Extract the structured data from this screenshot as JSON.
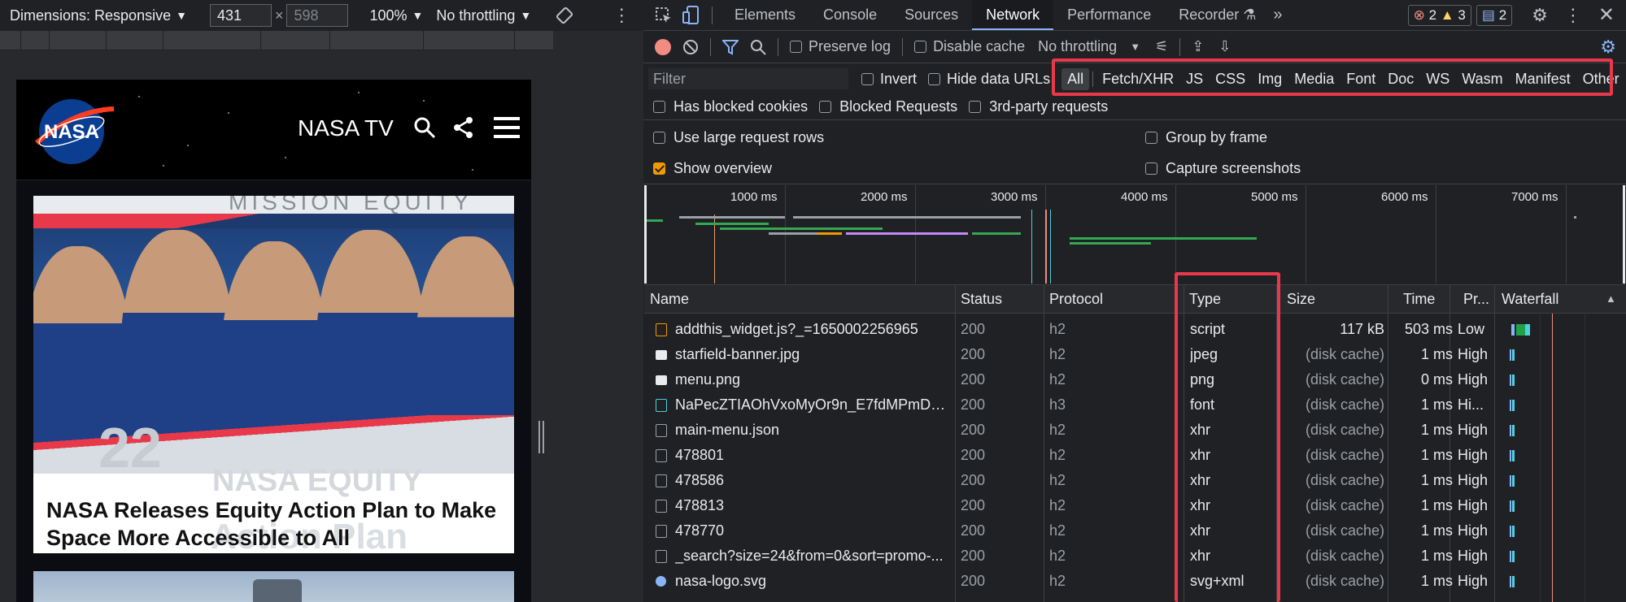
{
  "device_toolbar": {
    "dimensions_label": "Dimensions: Responsive",
    "width": "431",
    "height": "598",
    "zoom": "100%",
    "throttling": "No throttling"
  },
  "nasa_page": {
    "logo_text": "NASA",
    "nav_label": "NASA TV",
    "banner_text": "MISSION EQUITY",
    "card_title": "NASA Releases Equity Action Plan to Make Space More Accessible to All",
    "overlay_year": "22",
    "overlay_text_1": "NASA EQUITY",
    "overlay_text_2": "Action Plan"
  },
  "devtools": {
    "tabs": [
      {
        "label": "Elements"
      },
      {
        "label": "Console"
      },
      {
        "label": "Sources"
      },
      {
        "label": "Network"
      },
      {
        "label": "Performance"
      },
      {
        "label": "Recorder"
      }
    ],
    "active_tab": "Network",
    "errors": "2",
    "warnings": "3",
    "messages": "2",
    "toolbar": {
      "preserve_log": "Preserve log",
      "disable_cache": "Disable cache",
      "throttling": "No throttling"
    },
    "filter": {
      "placeholder": "Filter",
      "invert": "Invert",
      "hide_data_urls": "Hide data URLs",
      "types": [
        "All",
        "Fetch/XHR",
        "JS",
        "CSS",
        "Img",
        "Media",
        "Font",
        "Doc",
        "WS",
        "Wasm",
        "Manifest",
        "Other"
      ],
      "active_type": "All"
    },
    "options": {
      "has_blocked_cookies": "Has blocked cookies",
      "blocked_requests": "Blocked Requests",
      "third_party": "3rd-party requests",
      "large_rows": "Use large request rows",
      "group_by_frame": "Group by frame",
      "show_overview": "Show overview",
      "show_overview_checked": true,
      "capture_screenshots": "Capture screenshots"
    },
    "timeline_ticks": [
      "1000 ms",
      "2000 ms",
      "3000 ms",
      "4000 ms",
      "5000 ms",
      "6000 ms",
      "7000 ms"
    ],
    "columns": [
      "Name",
      "Status",
      "Protocol",
      "Type",
      "Size",
      "Time",
      "Pr...",
      "Waterfall"
    ],
    "rows": [
      {
        "name": "addthis_widget.js?_=1650002256965",
        "status": "200",
        "protocol": "h2",
        "type": "script",
        "size": "117 kB",
        "time": "503 ms",
        "priority": "Low",
        "icon": "script-file-icon"
      },
      {
        "name": "starfield-banner.jpg",
        "status": "200",
        "protocol": "h2",
        "type": "jpeg",
        "size": "(disk cache)",
        "time": "1 ms",
        "priority": "High",
        "icon": "image-file-icon"
      },
      {
        "name": "menu.png",
        "status": "200",
        "protocol": "h2",
        "type": "png",
        "size": "(disk cache)",
        "time": "0 ms",
        "priority": "High",
        "icon": "image-file-icon"
      },
      {
        "name": "NaPecZTIAOhVxoMyOr9n_E7fdMPmDa...",
        "status": "200",
        "protocol": "h3",
        "type": "font",
        "size": "(disk cache)",
        "time": "1 ms",
        "priority": "Hi...",
        "icon": "font-file-icon"
      },
      {
        "name": "main-menu.json",
        "status": "200",
        "protocol": "h2",
        "type": "xhr",
        "size": "(disk cache)",
        "time": "1 ms",
        "priority": "High",
        "icon": "document-file-icon"
      },
      {
        "name": "478801",
        "status": "200",
        "protocol": "h2",
        "type": "xhr",
        "size": "(disk cache)",
        "time": "1 ms",
        "priority": "High",
        "icon": "document-file-icon"
      },
      {
        "name": "478586",
        "status": "200",
        "protocol": "h2",
        "type": "xhr",
        "size": "(disk cache)",
        "time": "1 ms",
        "priority": "High",
        "icon": "document-file-icon"
      },
      {
        "name": "478813",
        "status": "200",
        "protocol": "h2",
        "type": "xhr",
        "size": "(disk cache)",
        "time": "1 ms",
        "priority": "High",
        "icon": "document-file-icon"
      },
      {
        "name": "478770",
        "status": "200",
        "protocol": "h2",
        "type": "xhr",
        "size": "(disk cache)",
        "time": "1 ms",
        "priority": "High",
        "icon": "document-file-icon"
      },
      {
        "name": "_search?size=24&from=0&sort=promo-...",
        "status": "200",
        "protocol": "h2",
        "type": "xhr",
        "size": "(disk cache)",
        "time": "1 ms",
        "priority": "High",
        "icon": "document-file-icon"
      },
      {
        "name": "nasa-logo.svg",
        "status": "200",
        "protocol": "h2",
        "type": "svg+xml",
        "size": "(disk cache)",
        "time": "1 ms",
        "priority": "High",
        "icon": "svg-file-icon"
      }
    ]
  }
}
